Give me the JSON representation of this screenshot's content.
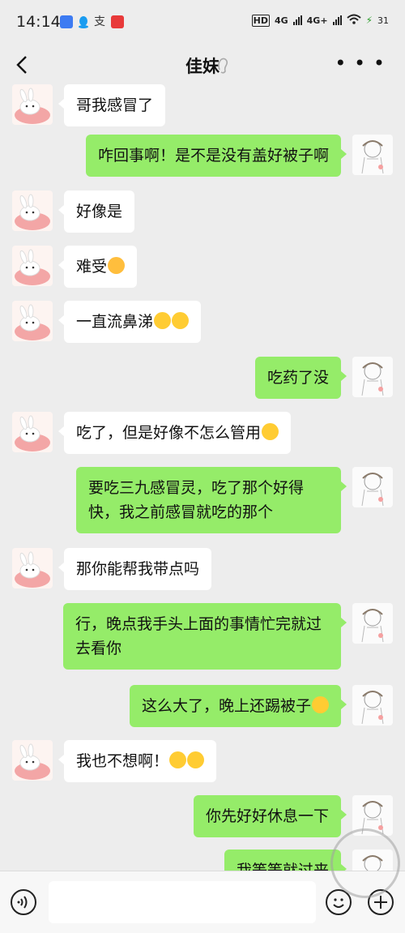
{
  "status_bar": {
    "time": "14:14",
    "signal1": "4G",
    "signal2": "4G+",
    "hd": "HD",
    "battery": "31"
  },
  "nav": {
    "title": "佳妹",
    "back_icon": "chevron-left-icon",
    "more_icon": "more-icon"
  },
  "messages": [
    {
      "side": "left",
      "text": "哥我感冒了"
    },
    {
      "side": "right",
      "text": "咋回事啊！是不是没有盖好被子啊"
    },
    {
      "side": "left",
      "text": "好像是"
    },
    {
      "side": "left",
      "text": "难受",
      "emoji": "sad-emoji"
    },
    {
      "side": "left",
      "text": "一直流鼻涕",
      "emoji": "smile-emoji"
    },
    {
      "side": "right",
      "text": "吃药了没"
    },
    {
      "side": "left",
      "text": "吃了，但是好像不怎么管用",
      "emoji": "thinking-emoji"
    },
    {
      "side": "right",
      "text": "要吃三九感冒灵，吃了那个好得快，我之前感冒就吃的那个"
    },
    {
      "side": "left",
      "text": "那你能帮我带点吗"
    },
    {
      "side": "right",
      "text": "行，晚点我手头上面的事情忙完就过去看你"
    },
    {
      "side": "right",
      "text": "这么大了，晚上还踢被子",
      "emoji": "sweat-emoji"
    },
    {
      "side": "left",
      "text": "我也不想啊！",
      "emoji": "smile-emoji"
    },
    {
      "side": "right",
      "text": "你先好好休息一下"
    },
    {
      "side": "right",
      "text": "我等等就过来"
    }
  ],
  "input_bar": {
    "voice_icon": "voice-icon",
    "emoji_icon": "emoji-icon",
    "plus_icon": "plus-icon",
    "text_value": ""
  },
  "colors": {
    "background": "#ededed",
    "outgoing_bubble": "#95ec69",
    "incoming_bubble": "#ffffff"
  }
}
